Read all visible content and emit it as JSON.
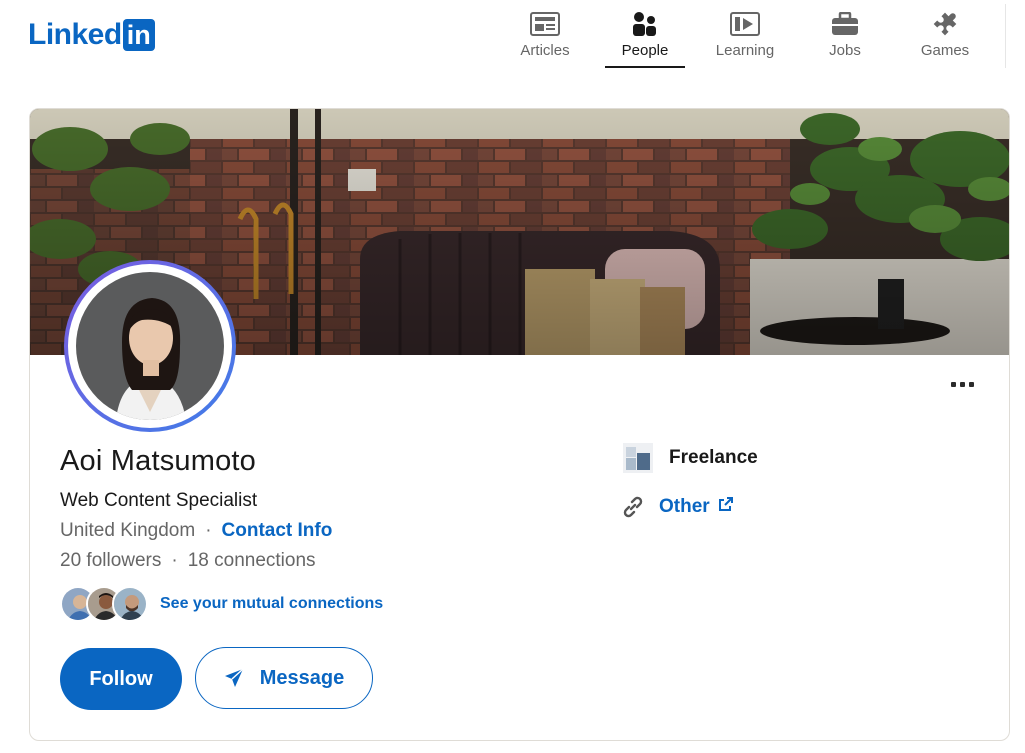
{
  "app": {
    "logo_text": "Linked",
    "logo_box": "in"
  },
  "nav": {
    "items": [
      {
        "label": "Articles",
        "icon": "articles-icon",
        "active": false
      },
      {
        "label": "People",
        "icon": "people-icon",
        "active": true
      },
      {
        "label": "Learning",
        "icon": "learning-icon",
        "active": false
      },
      {
        "label": "Jobs",
        "icon": "briefcase-icon",
        "active": false
      },
      {
        "label": "Games",
        "icon": "puzzle-icon",
        "active": false
      }
    ]
  },
  "profile": {
    "name": "Aoi Matsumoto",
    "headline": "Web Content Specialist",
    "location": "United Kingdom",
    "separator": "·",
    "contact_info_label": "Contact Info",
    "followers": "20 followers",
    "connections": "18 connections",
    "mutual_connections_label": "See your mutual connections",
    "company": "Freelance",
    "website_label": "Other"
  },
  "actions": {
    "follow_label": "Follow",
    "message_label": "Message"
  },
  "colors": {
    "brand_blue": "#0a66c2",
    "text_primary": "#191919",
    "text_secondary": "#666666",
    "avatar_ring": "#5b6fe0"
  }
}
